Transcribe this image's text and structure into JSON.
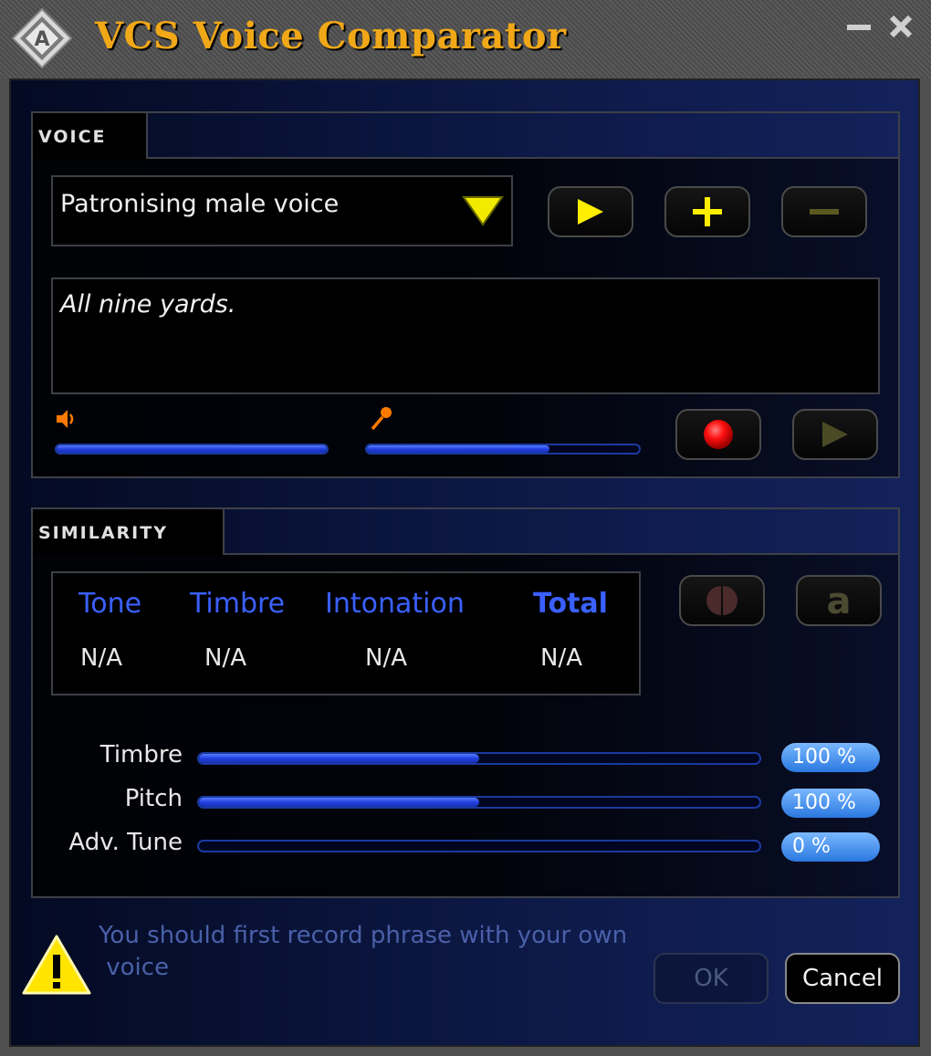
{
  "window": {
    "title": "VCS Voice Comparator",
    "minimize_icon": "minimize-icon",
    "close_icon": "close-icon"
  },
  "voice": {
    "section_label": "VOICE",
    "selected_voice": "Patronising male voice",
    "phrase": "All nine yards.",
    "speaker_volume": 1.0,
    "mic_volume": 0.67
  },
  "similarity": {
    "section_label": "SIMILARITY",
    "metrics": [
      {
        "label": "Tone",
        "value": "N/A"
      },
      {
        "label": "Timbre",
        "value": "N/A"
      },
      {
        "label": "Intonation",
        "value": "N/A"
      },
      {
        "label": "Total",
        "value": "N/A"
      }
    ],
    "sliders": [
      {
        "label": "Timbre",
        "percent_label": "100 %",
        "fill": 0.5
      },
      {
        "label": "Pitch",
        "percent_label": "100 %",
        "fill": 0.5
      },
      {
        "label": "Adv. Tune",
        "percent_label": "0 %",
        "fill": 0.0
      }
    ]
  },
  "footer": {
    "warning": "You should first record phrase with your own\n voice",
    "ok_label": "OK",
    "cancel_label": "Cancel"
  },
  "colors": {
    "title": "#f0a818",
    "metric_header": "#3a60ff",
    "accent_yellow": "#ffee00",
    "record_red": "#ff1010"
  }
}
